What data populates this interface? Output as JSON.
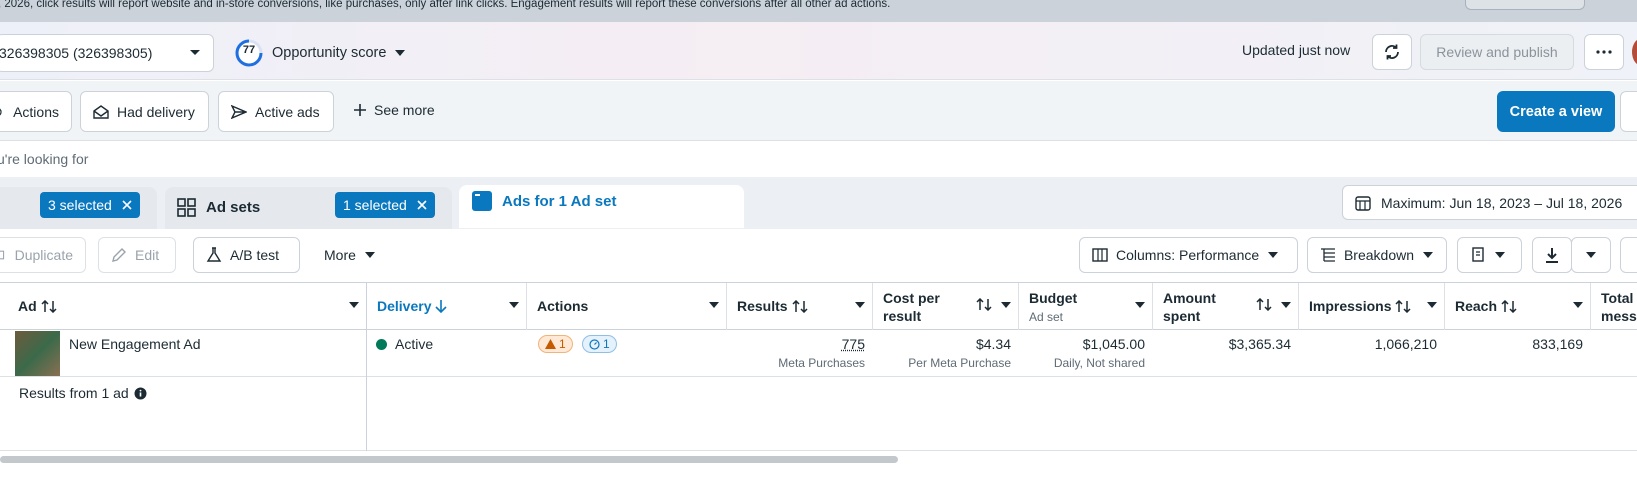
{
  "notice": {
    "text": ", 2026, click results will report website and in-store conversions, like purchases, only after link clicks. Engagement results will report these conversions after all other ad actions."
  },
  "topbar": {
    "account_label": "326398305 (326398305)",
    "opportunity_score": "77",
    "opportunity_label": "Opportunity score",
    "updated_text": "Updated just now",
    "review_label": "Review and publish"
  },
  "filters": {
    "items": [
      {
        "label": "Actions",
        "icon": "target-icon"
      },
      {
        "label": "Had delivery",
        "icon": "envelope-icon"
      },
      {
        "label": "Active ads",
        "icon": "send-icon"
      }
    ],
    "see_more": "See more",
    "create_view": "Create a view"
  },
  "search": {
    "placeholder": "u're looking for"
  },
  "tabs": {
    "campaigns_selected": "3 selected",
    "adsets_label": "Ad sets",
    "adsets_selected": "1 selected",
    "ads_label": "Ads for 1 Ad set"
  },
  "date_range": "Maximum: Jun 18, 2023 – Jul 18, 2026",
  "toolbar": {
    "duplicate": "Duplicate",
    "edit": "Edit",
    "ab_test": "A/B test",
    "more": "More",
    "columns": "Columns: Performance",
    "breakdown": "Breakdown"
  },
  "table": {
    "headers": {
      "ad": "Ad",
      "delivery": "Delivery",
      "actions": "Actions",
      "results": "Results",
      "cost_line1": "Cost per",
      "cost_line2": "result",
      "budget": "Budget",
      "budget_sub": "Ad set",
      "amount_line1": "Amount",
      "amount_line2": "spent",
      "impressions": "Impressions",
      "reach": "Reach",
      "total_line1": "Total",
      "total_line2": "messa"
    },
    "row": {
      "ad_name": "New Engagement Ad",
      "delivery": "Active",
      "warnings": "1",
      "recs": "1",
      "results": "775",
      "results_sub": "Meta Purchases",
      "cost": "$4.34",
      "cost_sub": "Per Meta Purchase",
      "budget": "$1,045.00",
      "budget_sub": "Daily, Not shared",
      "amount_spent": "$3,365.34",
      "impressions": "1,066,210",
      "reach": "833,169"
    },
    "footer": "Results from 1 ad"
  },
  "colors": {
    "accent": "#0a78be",
    "active_green": "#007a59",
    "warning": "#c55a00"
  }
}
